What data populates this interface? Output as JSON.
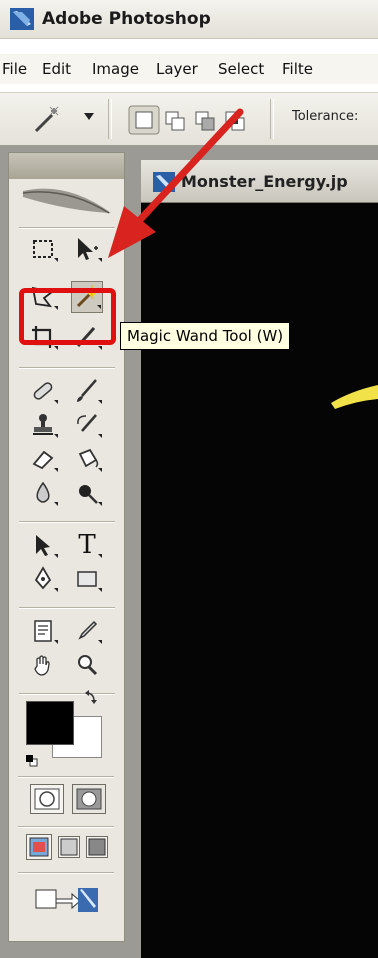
{
  "window": {
    "title": "Adobe Photoshop"
  },
  "menubar": {
    "items": [
      "File",
      "Edit",
      "Image",
      "Layer",
      "Select",
      "Filte"
    ]
  },
  "optionsbar": {
    "tolerance_label": "Tolerance:"
  },
  "toolbox": {
    "tools": [
      {
        "name": "rectangular-marquee-tool",
        "icon": "marquee-icon"
      },
      {
        "name": "move-tool",
        "icon": "move-icon"
      },
      {
        "name": "polygonal-lasso-tool",
        "icon": "lasso-icon"
      },
      {
        "name": "magic-wand-tool",
        "icon": "magic-wand-icon",
        "active": true
      },
      {
        "name": "crop-tool",
        "icon": "crop-icon"
      },
      {
        "name": "slice-tool",
        "icon": "slice-icon"
      },
      {
        "name": "healing-brush-tool",
        "icon": "bandage-icon"
      },
      {
        "name": "brush-tool",
        "icon": "brush-icon"
      },
      {
        "name": "clone-stamp-tool",
        "icon": "stamp-icon"
      },
      {
        "name": "history-brush-tool",
        "icon": "history-brush-icon"
      },
      {
        "name": "eraser-tool",
        "icon": "eraser-icon"
      },
      {
        "name": "paint-bucket-tool",
        "icon": "bucket-icon"
      },
      {
        "name": "blur-tool",
        "icon": "drop-icon"
      },
      {
        "name": "burn-tool",
        "icon": "burn-icon"
      },
      {
        "name": "path-selection-tool",
        "icon": "arrow-icon"
      },
      {
        "name": "type-tool",
        "icon": "type-icon",
        "glyph": "T"
      },
      {
        "name": "pen-tool",
        "icon": "pen-icon"
      },
      {
        "name": "rectangle-tool",
        "icon": "rectangle-icon"
      },
      {
        "name": "notes-tool",
        "icon": "notes-icon"
      },
      {
        "name": "eyedropper-tool",
        "icon": "eyedropper-icon"
      },
      {
        "name": "hand-tool",
        "icon": "hand-icon"
      },
      {
        "name": "zoom-tool",
        "icon": "magnifier-icon"
      }
    ],
    "foreground_color": "#000000",
    "background_color": "#ffffff"
  },
  "tooltip": {
    "text": "Magic Wand Tool (W)"
  },
  "document": {
    "title": "Monster_Energy.jp"
  },
  "colors": {
    "annotation_red": "#e01010",
    "canvas_black": "#000000",
    "artwork_yellow": "#f2e24a"
  }
}
